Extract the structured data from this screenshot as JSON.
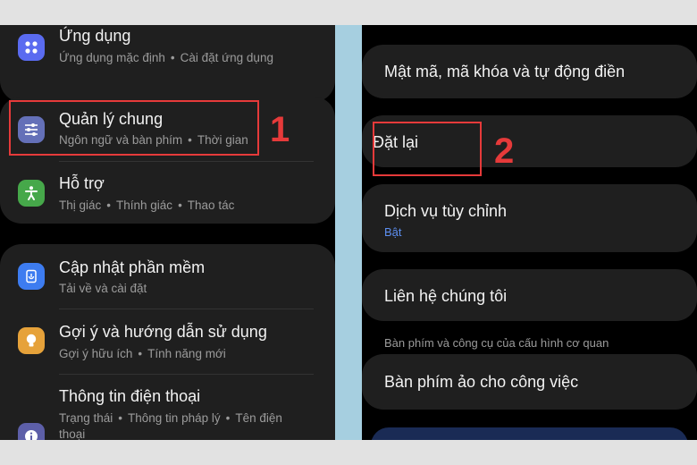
{
  "left_panel": {
    "items": [
      {
        "title": "Ứng dụng",
        "subtitle": [
          "Ứng dụng mặc định",
          "Cài đặt ứng dụng"
        ],
        "icon": "apps-grid-icon",
        "color": "#5a6bf0"
      },
      {
        "title": "Quản lý chung",
        "subtitle": [
          "Ngôn ngữ và bàn phím",
          "Thời gian"
        ],
        "icon": "sliders-icon",
        "color": "#6470b8"
      },
      {
        "title": "Hỗ trợ",
        "subtitle": [
          "Thị giác",
          "Thính giác",
          "Thao tác"
        ],
        "icon": "accessibility-icon",
        "color": "#46a84a"
      },
      {
        "title": "Cập nhật phần mềm",
        "subtitle": [
          "Tải về và cài đặt"
        ],
        "icon": "software-update-icon",
        "color": "#3d7cf0"
      },
      {
        "title": "Gợi ý và hướng dẫn sử dụng",
        "subtitle": [
          "Gợi ý hữu ích",
          "Tính năng mới"
        ],
        "icon": "lightbulb-icon",
        "color": "#e6a23a"
      },
      {
        "title": "Thông tin điện thoại",
        "subtitle": [
          "Trạng thái",
          "Thông tin pháp lý",
          "Tên điện thoại"
        ],
        "icon": "info-icon",
        "color": "#5d5fa8"
      }
    ]
  },
  "right_panel": {
    "items": [
      {
        "title": "Mật mã, mã khóa và tự động điền"
      },
      {
        "title": "Đặt lại"
      },
      {
        "title": "Dịch vụ tùy chỉnh",
        "subtitle": "Bật"
      },
      {
        "title": "Liên hệ chúng tôi"
      }
    ],
    "section_label": "Bàn phím và công cụ của cấu hình cơ quan",
    "work_item": {
      "title": "Bàn phím ảo cho công việc"
    }
  },
  "annotations": {
    "step1": "1",
    "step2": "2",
    "color": "#e63a3a"
  }
}
